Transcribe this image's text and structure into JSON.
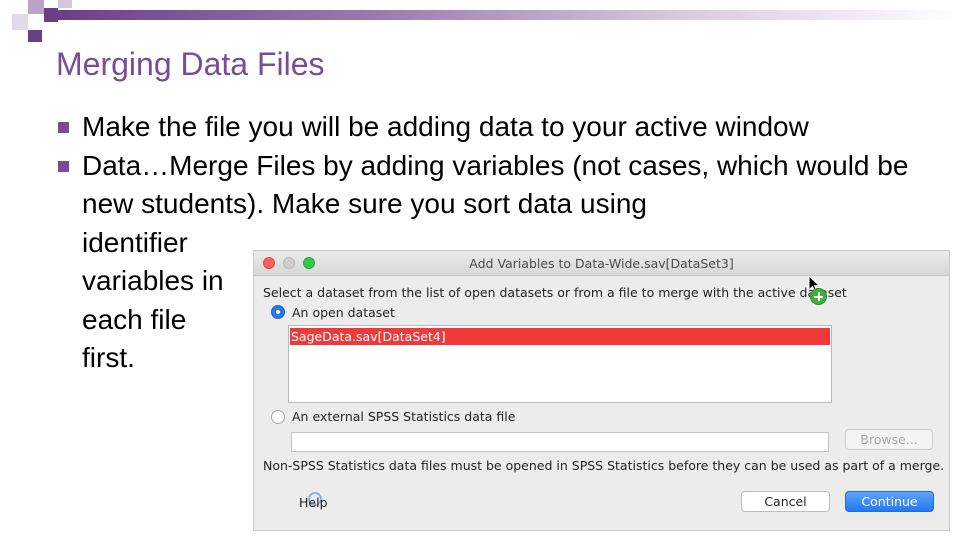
{
  "slide": {
    "title": "Merging Data Files",
    "bullets": [
      "Make the file you will be adding data to your active window",
      "Data…Merge Files by adding variables (not cases, which would be new students).  Make sure you sort data using",
      "identifier variables in each file first."
    ]
  },
  "dialog": {
    "title": "Add Variables to Data-Wide.sav[DataSet3]",
    "prompt": "Select a dataset from the list of open datasets or from a file to merge with the active dataset",
    "option_open": "An open dataset",
    "open_datasets": [
      "SageData.sav[DataSet4]"
    ],
    "option_external": "An external SPSS Statistics data file",
    "file_value": "",
    "browse_label": "Browse...",
    "note": "Non-SPSS Statistics data files must be opened in SPSS Statistics before they can be used as part of a merge.",
    "help_label": "Help",
    "cancel_label": "Cancel",
    "continue_label": "Continue"
  },
  "colors": {
    "accent": "#7a4c97",
    "selection": "#f03a3a",
    "primary_button": "#2478f0"
  },
  "icons": {
    "bullet": "square-bullet-icon",
    "cursor": "arrow-cursor-icon",
    "copy_badge": "green-plus-icon"
  }
}
